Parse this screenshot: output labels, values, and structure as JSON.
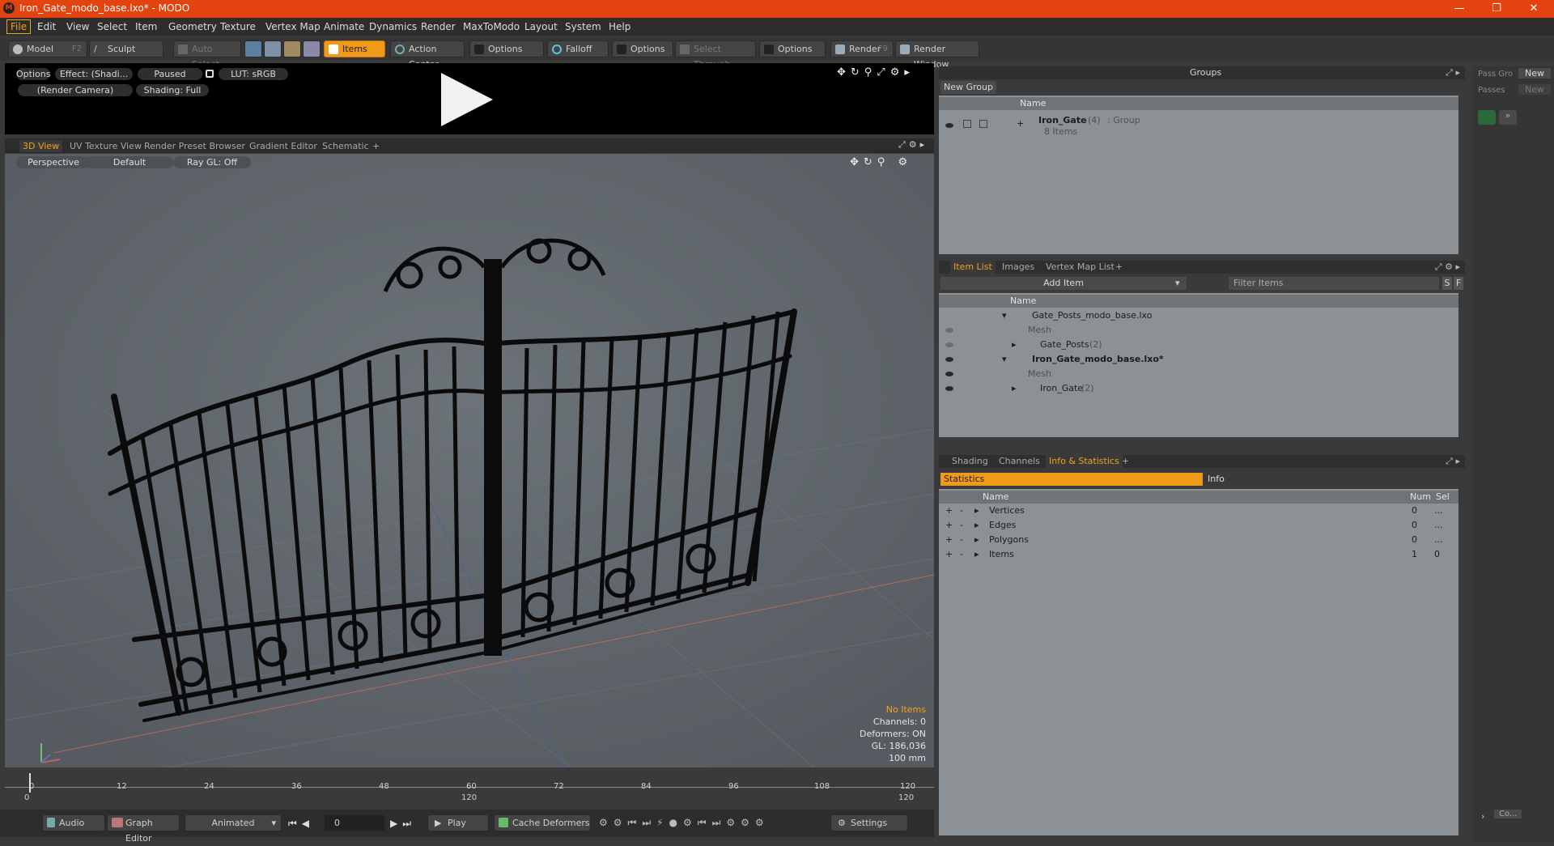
{
  "window": {
    "title": "Iron_Gate_modo_base.lxo* - MODO",
    "controls": [
      "—",
      "❐",
      "✕"
    ]
  },
  "menu": [
    "File",
    "Edit",
    "View",
    "Select",
    "Item",
    "Geometry",
    "Texture",
    "Vertex Map",
    "Animate",
    "Dynamics",
    "Render",
    "MaxToModo",
    "Layout",
    "System",
    "Help"
  ],
  "toolbar": {
    "model": "Model",
    "model_key": "F2",
    "sculpt": "Sculpt",
    "auto_select": "Auto Select",
    "items": "Items",
    "action_center": "Action Center",
    "options1": "Options",
    "falloff": "Falloff",
    "options2": "Options",
    "select_through": "Select Through",
    "options3": "Options",
    "render": "Render",
    "render_key": "F9",
    "render_window": "Render Window"
  },
  "preview": {
    "options": "Options",
    "effect": "Effect: (Shadi...",
    "paused": "Paused",
    "lut": "LUT: sRGB",
    "camera": "(Render Camera)",
    "shading": "Shading: Full"
  },
  "viewport_tabs": [
    "3D View",
    "UV Texture View",
    "Render Preset Browser",
    "Gradient Editor",
    "Schematic",
    "+"
  ],
  "viewport": {
    "perspective": "Perspective",
    "default": "Default",
    "raygl": "Ray GL: Off",
    "stats": {
      "no_items": "No Items",
      "channels": "Channels: 0",
      "deformers": "Deformers: ON",
      "gl": "GL: 186,036",
      "scale": "100 mm"
    }
  },
  "timeline": {
    "ticks": [
      "0",
      "12",
      "24",
      "36",
      "48",
      "60",
      "72",
      "84",
      "96",
      "108",
      "120"
    ],
    "range_start": "0",
    "range_mid": "120",
    "range_end": "120"
  },
  "bottombar": {
    "audio": "Audio",
    "graph_editor": "Graph Editor",
    "animated": "Animated",
    "frame": "0",
    "play": "Play",
    "cache": "Cache Deformers",
    "settings": "Settings"
  },
  "groups": {
    "title": "Groups",
    "new_group": "New Group",
    "col_name": "Name",
    "item_name": "Iron_Gate",
    "item_count": "(4)",
    "item_type": ": Group",
    "item_sub": "8 Items"
  },
  "pass": {
    "label1": "Pass Gro",
    "new1": "New",
    "label2": "Passes",
    "new2": "New"
  },
  "itemlist": {
    "tabs": [
      "Item List",
      "Images",
      "Vertex Map List",
      "+"
    ],
    "add_item": "Add Item",
    "filter": "Filter Items",
    "s": "S",
    "f": "F",
    "col_name": "Name",
    "rows": [
      {
        "name": "Gate_Posts_modo_base.lxo",
        "count": "",
        "style": "normal"
      },
      {
        "name": "Mesh",
        "count": "",
        "style": "grey"
      },
      {
        "name": "Gate_Posts",
        "count": "(2)",
        "style": "normal"
      },
      {
        "name": "Iron_Gate_modo_base.lxo*",
        "count": "",
        "style": "bold"
      },
      {
        "name": "Mesh",
        "count": "",
        "style": "grey"
      },
      {
        "name": "Iron_Gate",
        "count": "(2)",
        "style": "normal"
      }
    ]
  },
  "stats": {
    "tabs": [
      "Shading",
      "Channels",
      "Info & Statistics",
      "+"
    ],
    "subtabs": [
      "Statistics",
      "Info"
    ],
    "cols": [
      "Name",
      "Num",
      "Sel"
    ],
    "rows": [
      {
        "name": "Vertices",
        "num": "0",
        "sel": "..."
      },
      {
        "name": "Edges",
        "num": "0",
        "sel": "..."
      },
      {
        "name": "Polygons",
        "num": "0",
        "sel": "..."
      },
      {
        "name": "Items",
        "num": "1",
        "sel": "0"
      }
    ]
  },
  "far_right": {
    "bottom_btn": "Co..."
  },
  "colors": {
    "title_bar": "#e2430f",
    "accent": "#f0a020",
    "panel": "#8c9196"
  }
}
